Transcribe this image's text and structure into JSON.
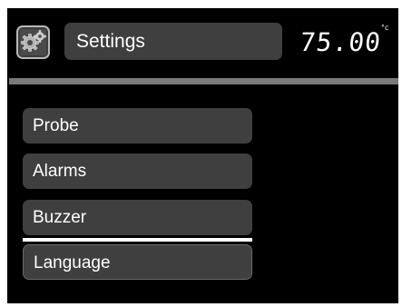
{
  "header": {
    "icon": "gears-icon",
    "title": "Settings",
    "temperature": "75.00",
    "temperature_unit": "°c"
  },
  "menu": {
    "items": [
      {
        "label": "Probe"
      },
      {
        "label": "Alarms"
      },
      {
        "label": "Buzzer"
      },
      {
        "label": "Language"
      }
    ],
    "selected_item": "Language"
  },
  "colors": {
    "screen_background": "#000000",
    "panel": "#3f3f3f",
    "text": "#ffffff",
    "divider": "#7a7a7a",
    "selection_underline": "#ffffff"
  }
}
